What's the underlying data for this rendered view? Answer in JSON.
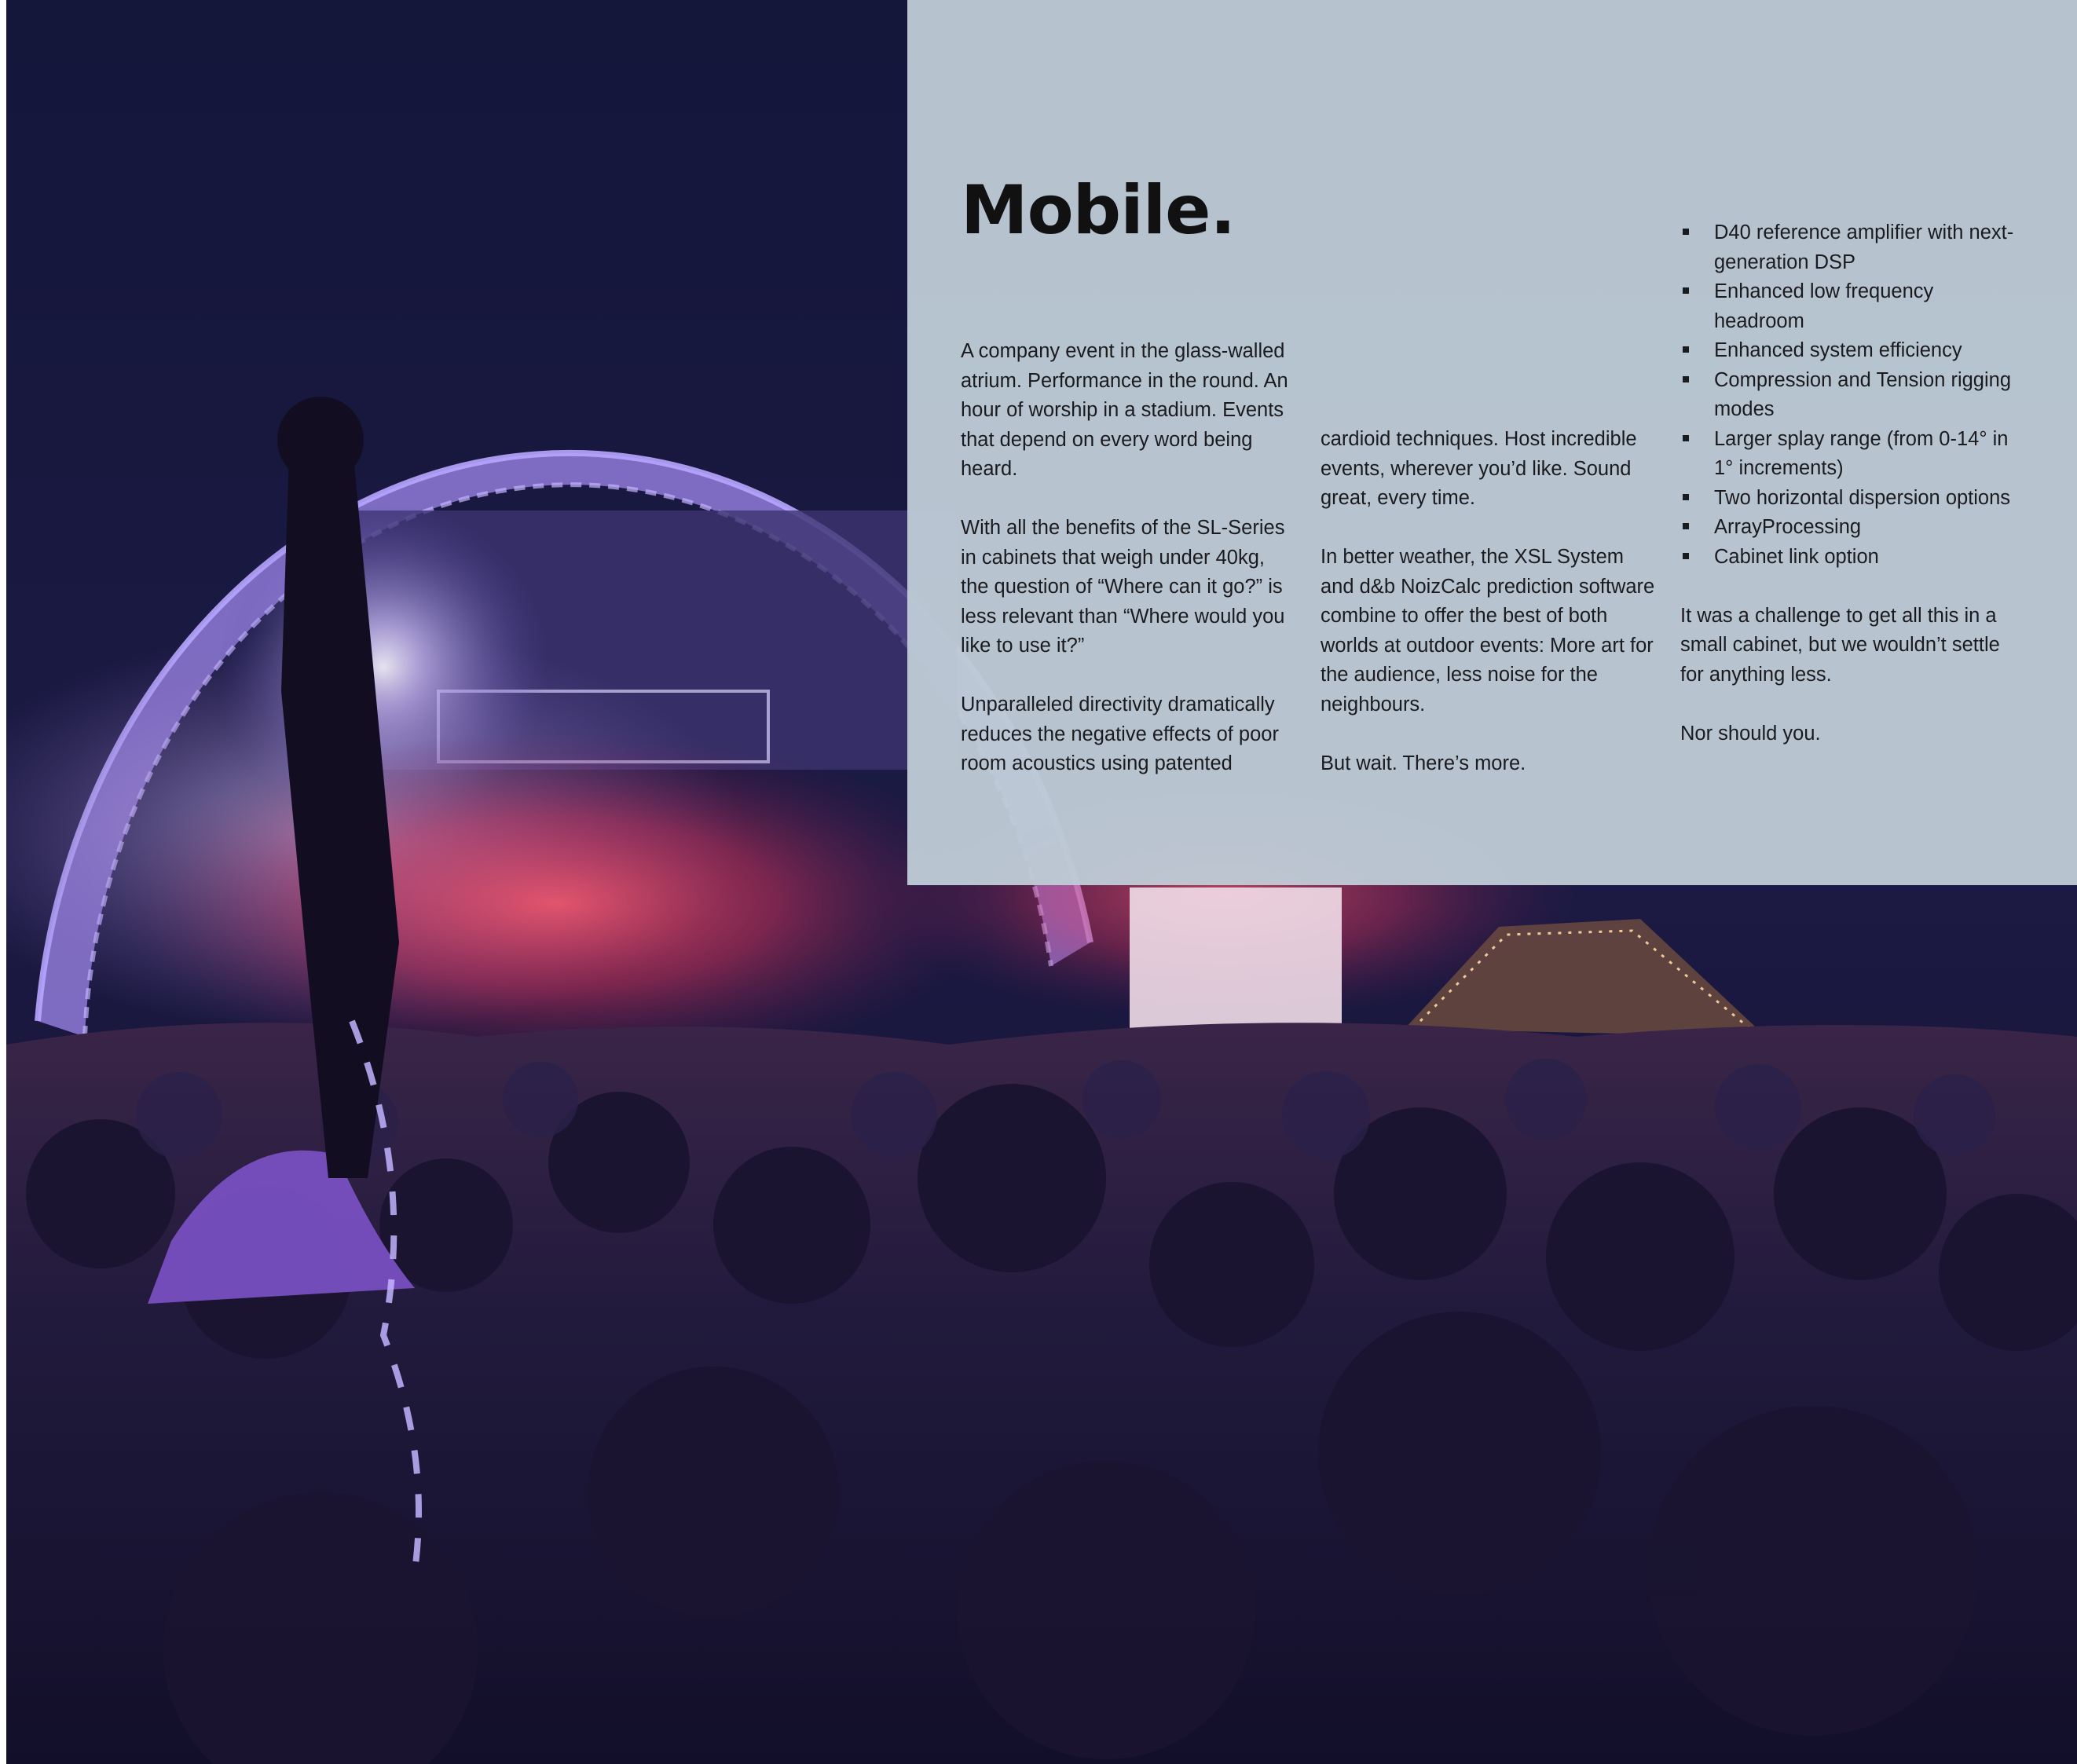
{
  "page": {
    "title": "Mobile.",
    "col1": {
      "p1": "A company event in the glass-walled atrium. Performance in the round. An hour of worship in a stadium. Events that depend on every word being heard.",
      "p2": "With all the benefits of the SL-Series in cabinets that weigh under 40kg, the question of “Where can it go?” is less relevant than “Where would you like to use it?”",
      "p3": "Unparalleled directivity dramatically reduces the negative effects of poor room acoustics using patented"
    },
    "col2": {
      "p1": "cardioid techniques. Host incredible events, wherever you’d like. Sound great, every time.",
      "p2": "In better weather, the XSL System and d&b NoizCalc prediction software combine to offer the best of both worlds at outdoor events: More art for the audience, less noise for the neighbours.",
      "p3": "But wait. There’s more."
    },
    "col3": {
      "bullets": [
        "D40 reference amplifier with next-generation DSP",
        "Enhanced low frequency headroom",
        "Enhanced system efficiency",
        "Compression and Tension rigging modes",
        "Larger splay range (from 0-14° in 1° increments)",
        "Two horizontal dispersion options",
        "ArrayProcessing",
        "Cabinet link option"
      ],
      "p1": "It was a challenge to get all this in a small cabinet, but we wouldn’t settle for anything less.",
      "p2": "Nor should you."
    }
  },
  "colors": {
    "panel": "#bdcbd5",
    "night_sky": "#15163a",
    "stage_light": "#e04a7a",
    "truss": "#a58be0",
    "crowd": "#0f0d24"
  }
}
